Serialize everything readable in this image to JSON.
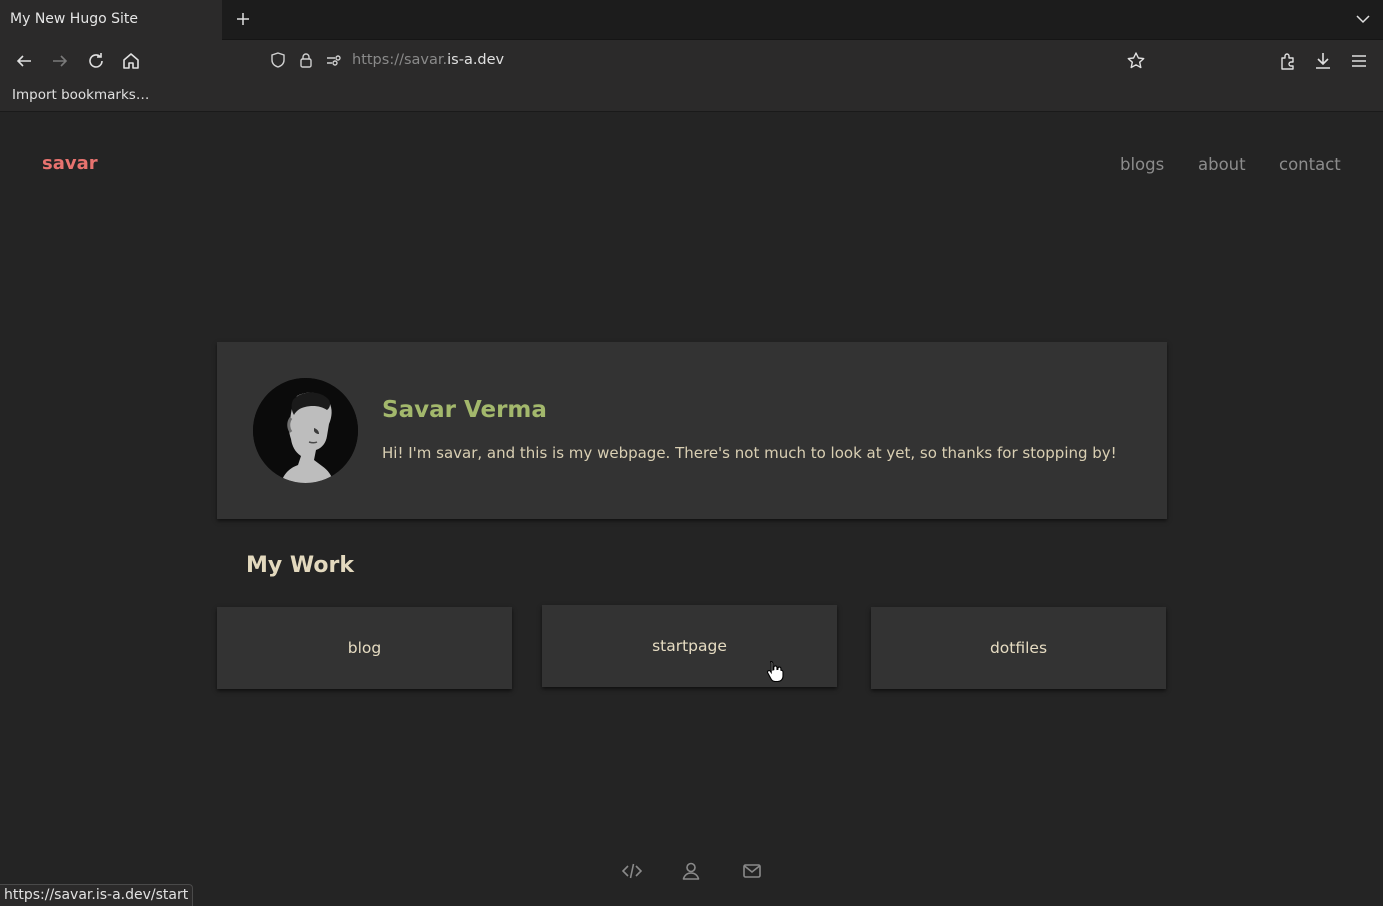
{
  "browser": {
    "tab_title": "My New Hugo Site",
    "url_prefix": "https://savar.",
    "url_host": "is-a.dev",
    "bookmarks_import": "Import bookmarks…",
    "status_url": "https://savar.is-a.dev/start",
    "icons": [
      "back-icon",
      "forward-icon",
      "reload-icon",
      "home-icon",
      "shield-icon",
      "lock-icon",
      "permissions-icon",
      "star-icon",
      "extensions-icon",
      "download-icon",
      "menu-icon",
      "new-tab-icon",
      "tab-list-icon"
    ]
  },
  "site": {
    "logo": "savar",
    "nav": [
      "blogs",
      "about",
      "contact"
    ],
    "profile": {
      "name": "Savar Verma",
      "bio": "Hi! I'm savar, and this is my webpage. There's not much to look at yet, so thanks for stopping by!"
    },
    "work_title": "My Work",
    "work_items": [
      "blog",
      "startpage",
      "dotfiles"
    ],
    "footer_icons": [
      "code-icon",
      "user-icon",
      "mail-icon"
    ]
  },
  "colors": {
    "background": "#242424",
    "card": "#333333",
    "logo": "#e8736f",
    "name": "#a3b86c",
    "text": "#d9cfb3"
  }
}
